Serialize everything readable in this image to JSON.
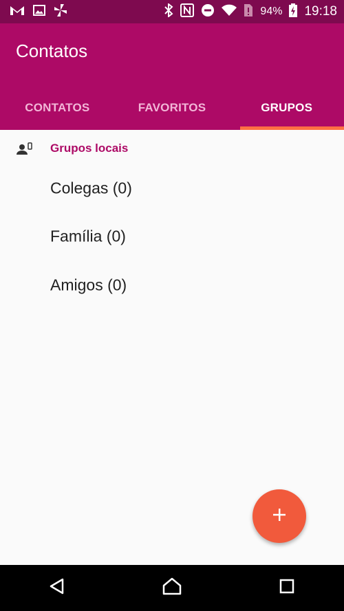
{
  "status_bar": {
    "left_icons": [
      "gmail-icon",
      "image-icon",
      "pinwheel-icon"
    ],
    "right_icons": [
      "bluetooth-icon",
      "nfc-icon",
      "do-not-disturb-icon",
      "wifi-icon",
      "sim-alert-icon",
      "battery-charging-icon"
    ],
    "battery": "94%",
    "time": "19:18"
  },
  "app_bar": {
    "title": "Contatos"
  },
  "tabs": [
    {
      "label": "CONTATOS",
      "active": false
    },
    {
      "label": "FAVORITOS",
      "active": false
    },
    {
      "label": "GRUPOS",
      "active": true
    }
  ],
  "section": {
    "title": "Grupos locais",
    "icon": "local-account-icon"
  },
  "groups": [
    {
      "label": "Colegas (0)"
    },
    {
      "label": "Família (0)"
    },
    {
      "label": "Amigos (0)"
    }
  ],
  "fab": {
    "icon": "plus-icon"
  },
  "nav_bar": {
    "buttons": [
      "back-icon",
      "home-icon",
      "recents-icon"
    ]
  },
  "colors": {
    "status_bar": "#7e0a4f",
    "primary": "#ad0a66",
    "accent": "#ff7043",
    "fab": "#f15a3c"
  }
}
